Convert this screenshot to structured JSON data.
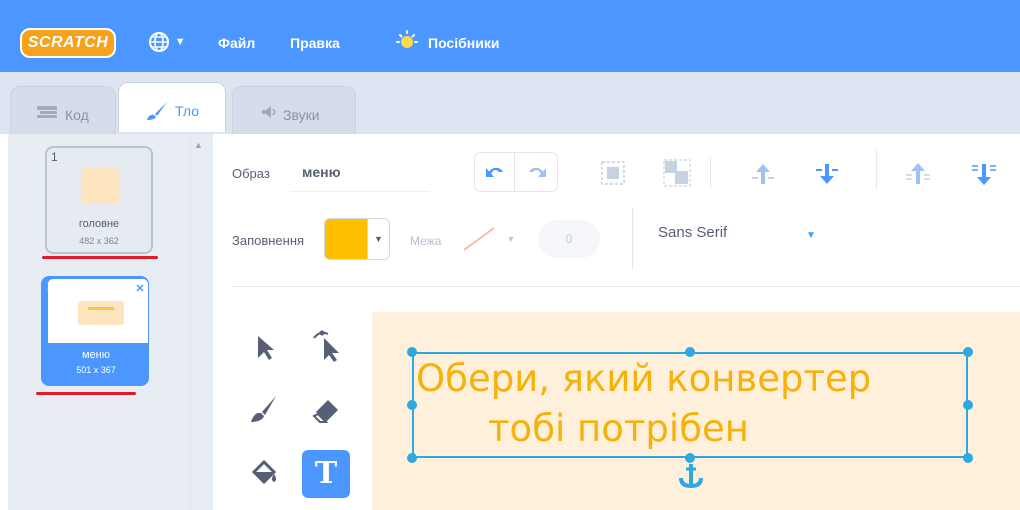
{
  "menubar": {
    "logo": "SCRATCH",
    "file": "Файл",
    "edit": "Правка",
    "tutorials": "Посібники",
    "icons": [
      "globe-icon",
      "bulb-icon"
    ]
  },
  "tabs": [
    {
      "label": "Код",
      "icon": "code-blocks-icon",
      "active": false
    },
    {
      "label": "Тло",
      "icon": "brush-icon",
      "active": true
    },
    {
      "label": "Звуки",
      "icon": "speaker-icon",
      "active": false
    }
  ],
  "costumes": [
    {
      "number": "1",
      "name": "головне",
      "size": "482 x 362",
      "selected": false
    },
    {
      "number": "2",
      "name": "меню",
      "size": "501 x 367",
      "selected": true
    }
  ],
  "editor": {
    "costume_label": "Образ",
    "costume_name": "меню",
    "fill_label": "Заповнення",
    "outline_label": "Межа",
    "outline_width": "0",
    "font": "Sans Serif",
    "fill_color": "#ffbf00",
    "canvas_text_line1": "Обери, який конвертер",
    "canvas_text_line2": "тобі потрібен"
  },
  "colors": {
    "accent": "#4c97ff",
    "underline": "#e01b24",
    "text_fill": "#f6b20a",
    "canvas_bg": "#fff0dc"
  }
}
